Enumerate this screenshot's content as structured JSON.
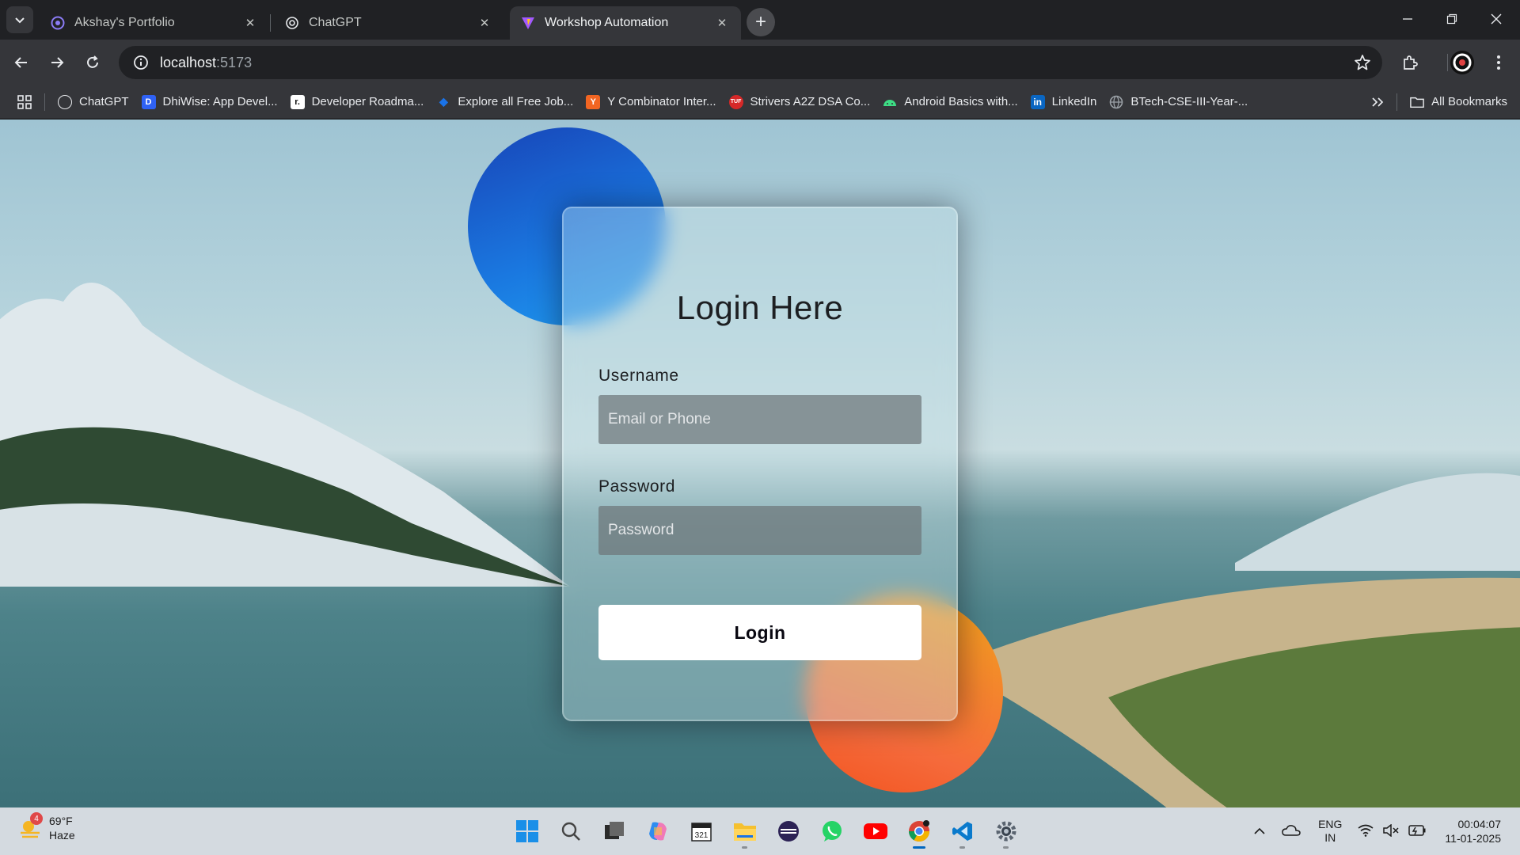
{
  "browser": {
    "tabs": [
      {
        "title": "Akshay's Portfolio",
        "active": false
      },
      {
        "title": "ChatGPT",
        "active": false
      },
      {
        "title": "Workshop Automation",
        "active": true
      }
    ],
    "url_host": "localhost",
    "url_port": ":5173",
    "bookmarks": [
      {
        "label": "ChatGPT",
        "icon": "chatgpt-icon",
        "color": "#202124"
      },
      {
        "label": "DhiWise: App Devel...",
        "icon": "dhiwise-icon",
        "color": "#2f62f5"
      },
      {
        "label": "Developer Roadma...",
        "icon": "roadmap-icon",
        "color": "#ffffff"
      },
      {
        "label": "Explore all Free Job...",
        "icon": "job-icon",
        "color": "#1a73e8"
      },
      {
        "label": "Y Combinator Inter...",
        "icon": "ycombinator-icon",
        "color": "#f26522"
      },
      {
        "label": "Strivers A2Z DSA Co...",
        "icon": "tuf-icon",
        "color": "#d62828"
      },
      {
        "label": "Android Basics with...",
        "icon": "android-icon",
        "color": "#3ddc84"
      },
      {
        "label": "LinkedIn",
        "icon": "linkedin-icon",
        "color": "#0a66c2"
      },
      {
        "label": "BTech-CSE-III-Year-...",
        "icon": "globe-icon",
        "color": "#9aa0a6"
      }
    ],
    "all_bookmarks_label": "All Bookmarks"
  },
  "login": {
    "title": "Login Here",
    "username_label": "Username",
    "username_placeholder": "Email or Phone",
    "password_label": "Password",
    "password_placeholder": "Password",
    "button_label": "Login"
  },
  "taskbar": {
    "weather_temp": "69°F",
    "weather_desc": "Haze",
    "weather_badge": "4",
    "lang_top": "ENG",
    "lang_bottom": "IN",
    "time": "00:04:07",
    "date": "11-01-2025"
  },
  "colors": {
    "accent_blue": "#1a78e0",
    "accent_orange": "#f56a3b",
    "chrome_dark": "#202124"
  }
}
